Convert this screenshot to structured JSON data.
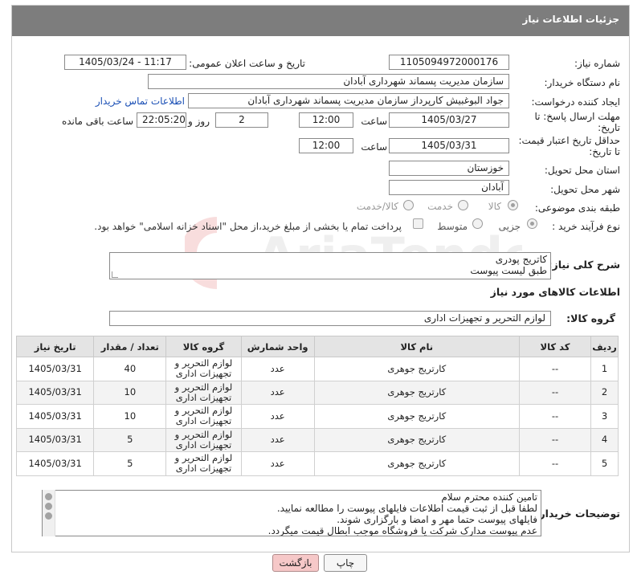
{
  "header": {
    "title": "جزئیات اطلاعات نیاز"
  },
  "form": {
    "need_number_label": "شماره نیاز:",
    "need_number": "1105094972000176",
    "announce_label": "تاریخ و ساعت اعلان عمومی:",
    "announce_value": "1405/03/24 - 11:17",
    "buyer_org_label": "نام دستگاه خریدار:",
    "buyer_org": "سازمان مدیریت پسماند شهرداری آبادان",
    "creator_label": "ایجاد کننده درخواست:",
    "creator": "جواد البوغبیش کارپرداز سازمان مدیریت پسماند شهرداری آبادان",
    "contact_link": "اطلاعات تماس خریدار",
    "deadline_label_1": "مهلت ارسال پاسخ: تا",
    "deadline_label_2": "تاریخ:",
    "deadline_date": "1405/03/27",
    "time_label": "ساعت",
    "deadline_time": "12:00",
    "days_value": "2",
    "days_label": "روز و",
    "remaining_time": "22:05:20",
    "remaining_label": "ساعت باقی مانده",
    "validity_label_1": "حداقل تاریخ اعتبار قیمت:",
    "validity_label_2": "تا تاریخ:",
    "validity_date": "1405/03/31",
    "validity_time_label": "ساعت",
    "validity_time": "12:00",
    "province_label": "استان محل تحویل:",
    "province": "خوزستان",
    "city_label": "شهر محل تحویل:",
    "city": "آبادان",
    "category_label": "طبقه بندی موضوعی:",
    "category_options": [
      "کالا",
      "خدمت",
      "کالا/خدمت"
    ],
    "category_selected": "کالا",
    "process_label": "نوع فرآیند خرید :",
    "process_options": [
      "جزیی",
      "متوسط"
    ],
    "process_selected": "جزیی",
    "treasury_note": "پرداخت تمام یا بخشی از مبلغ خرید،از محل \"اسناد خزانه اسلامی\" خواهد بود."
  },
  "description": {
    "label": "شرح کلی نیاز:",
    "line1": "کاتریج پودری",
    "line2": "طبق لیست پیوست"
  },
  "goods": {
    "section_title": "اطلاعات کالاهای مورد نیاز",
    "group_label": "گروه کالا:",
    "group_value": "لوازم التحریر و تجهیزات اداری",
    "columns": [
      "ردیف",
      "کد کالا",
      "نام کالا",
      "واحد شمارش",
      "گروه کالا",
      "تعداد / مقدار",
      "تاریخ نیاز"
    ],
    "rows": [
      {
        "row": "1",
        "code": "--",
        "name": "کارتریج جوهری",
        "unit": "عدد",
        "group1": "لوازم التحریر و",
        "group2": "تجهیزات اداری",
        "qty": "40",
        "date": "1405/03/31"
      },
      {
        "row": "2",
        "code": "--",
        "name": "کارتریج جوهری",
        "unit": "عدد",
        "group1": "لوازم التحریر و",
        "group2": "تجهیزات اداری",
        "qty": "10",
        "date": "1405/03/31"
      },
      {
        "row": "3",
        "code": "--",
        "name": "کارتریج جوهری",
        "unit": "عدد",
        "group1": "لوازم التحریر و",
        "group2": "تجهیزات اداری",
        "qty": "10",
        "date": "1405/03/31"
      },
      {
        "row": "4",
        "code": "--",
        "name": "کارتریج جوهری",
        "unit": "عدد",
        "group1": "لوازم التحریر و",
        "group2": "تجهیزات اداری",
        "qty": "5",
        "date": "1405/03/31"
      },
      {
        "row": "5",
        "code": "--",
        "name": "کارتریج جوهری",
        "unit": "عدد",
        "group1": "لوازم التحریر و",
        "group2": "تجهیزات اداری",
        "qty": "5",
        "date": "1405/03/31"
      }
    ]
  },
  "buyer_notes": {
    "label": "توضیحات خریدار:",
    "lines": [
      "تامین کننده محترم سلام",
      "لطفا قبل از ثبت قیمت اطلاعات فایلهای پیوست را مطالعه نمایید.",
      "فایلهای پیوست حتما مهر و امضا و بارگزاری شوند.",
      "عدم پیوست مدارک شرکت یا فروشگاه موجب ابطال قیمت میگردد."
    ]
  },
  "actions": {
    "print": "چاپ",
    "back": "بازگشت"
  },
  "watermark": {
    "text": "AriaTender.neT"
  },
  "colors": {
    "header_bg": "#7d7d7d",
    "back_button": "#f6c8c8",
    "link": "#1a4fb5"
  }
}
